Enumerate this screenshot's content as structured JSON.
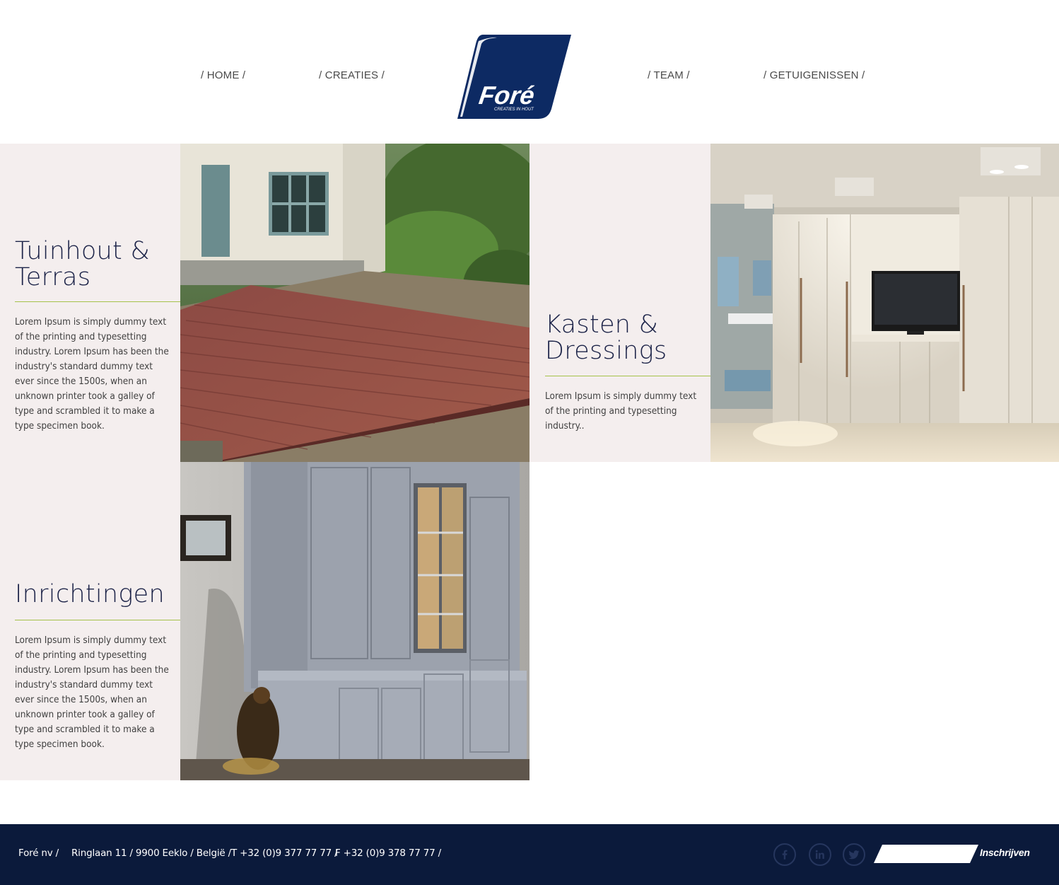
{
  "nav": {
    "home": "/ HOME /",
    "creaties": "/ CREATIES /",
    "team": "/ TEAM /",
    "getuigenissen": "/ GETUIGENISSEN /"
  },
  "logo": {
    "name": "Foré",
    "tagline": "CREATIES IN HOUT",
    "color": "#0d2a63"
  },
  "sections": [
    {
      "title_line1": "Tuinhout &",
      "title_line2": "Terras",
      "text": "Lorem Ipsum is simply dummy text of the printing and typesetting industry. Lorem Ipsum has been the industry's standard dummy text ever since the 1500s, when an unknown printer took a galley of type and scrambled it to make a type specimen book.",
      "image": "wooden-deck-photo"
    },
    {
      "title_line1": "Kasten &",
      "title_line2": "Dressings",
      "text": "Lorem Ipsum is simply dummy text of the printing and typesetting industry..",
      "image": "wardrobe-bedroom-photo"
    },
    {
      "title_line1": "Inrichtingen",
      "text": "Lorem Ipsum is simply dummy text of the printing and typesetting industry. Lorem Ipsum has been the industry's standard dummy text ever since the 1500s, when an unknown printer took a galley of type and scrambled it to make a type specimen book.",
      "image": "grey-cabinet-photo"
    }
  ],
  "footer": {
    "company": "Foré nv /",
    "address": "Ringlaan 11 / 9900 Eeklo / België /",
    "phone": "T +32 (0)9 377 77 77 /",
    "fax": "F +32 (0)9 378 77 77 /",
    "social": [
      "facebook-icon",
      "linkedin-icon",
      "twitter-icon"
    ],
    "subscribe_placeholder": "",
    "subscribe_label": "Inschrijven"
  },
  "colors": {
    "panel_bg": "#f4eeee",
    "title": "#1c2348",
    "accent_rule": "#a5c14a",
    "footer_bg": "#0b1a3b"
  }
}
